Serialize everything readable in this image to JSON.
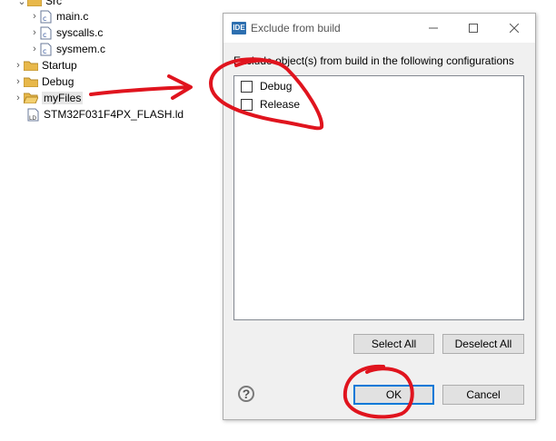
{
  "tree": {
    "items": [
      {
        "label": "Src"
      },
      {
        "label": "main.c"
      },
      {
        "label": "syscalls.c"
      },
      {
        "label": "sysmem.c"
      },
      {
        "label": "Startup"
      },
      {
        "label": "Debug"
      },
      {
        "label": "myFiles"
      },
      {
        "label": "STM32F031F4PX_FLASH.ld"
      }
    ]
  },
  "dialog": {
    "app_icon": "IDE",
    "title": "Exclude from build",
    "description": "Exclude object(s) from build in the following configurations",
    "configurations": [
      {
        "label": "Debug",
        "checked": false
      },
      {
        "label": "Release",
        "checked": false
      }
    ],
    "select_all": "Select All",
    "deselect_all": "Deselect All",
    "ok": "OK",
    "cancel": "Cancel",
    "help": "?"
  },
  "colors": {
    "annotation": "#e0141e",
    "dialog_bg": "#f0f0f0",
    "accent": "#0078d7"
  }
}
